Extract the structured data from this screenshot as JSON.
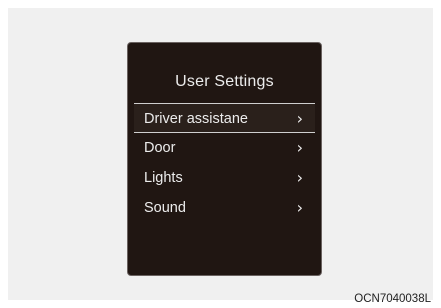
{
  "screen": {
    "title": "User Settings",
    "items": [
      {
        "label": "Driver assistane",
        "chevron": "›",
        "selected": true
      },
      {
        "label": "Door",
        "chevron": "›",
        "selected": false
      },
      {
        "label": "Lights",
        "chevron": "›",
        "selected": false
      },
      {
        "label": "Sound",
        "chevron": "›",
        "selected": false
      }
    ]
  },
  "figure_code": "OCN7040038L",
  "colors": {
    "display_bg": "#201612",
    "text": "#ececec",
    "highlight_line": "#cfcfcf",
    "frame_bg": "#f0f0f0"
  }
}
